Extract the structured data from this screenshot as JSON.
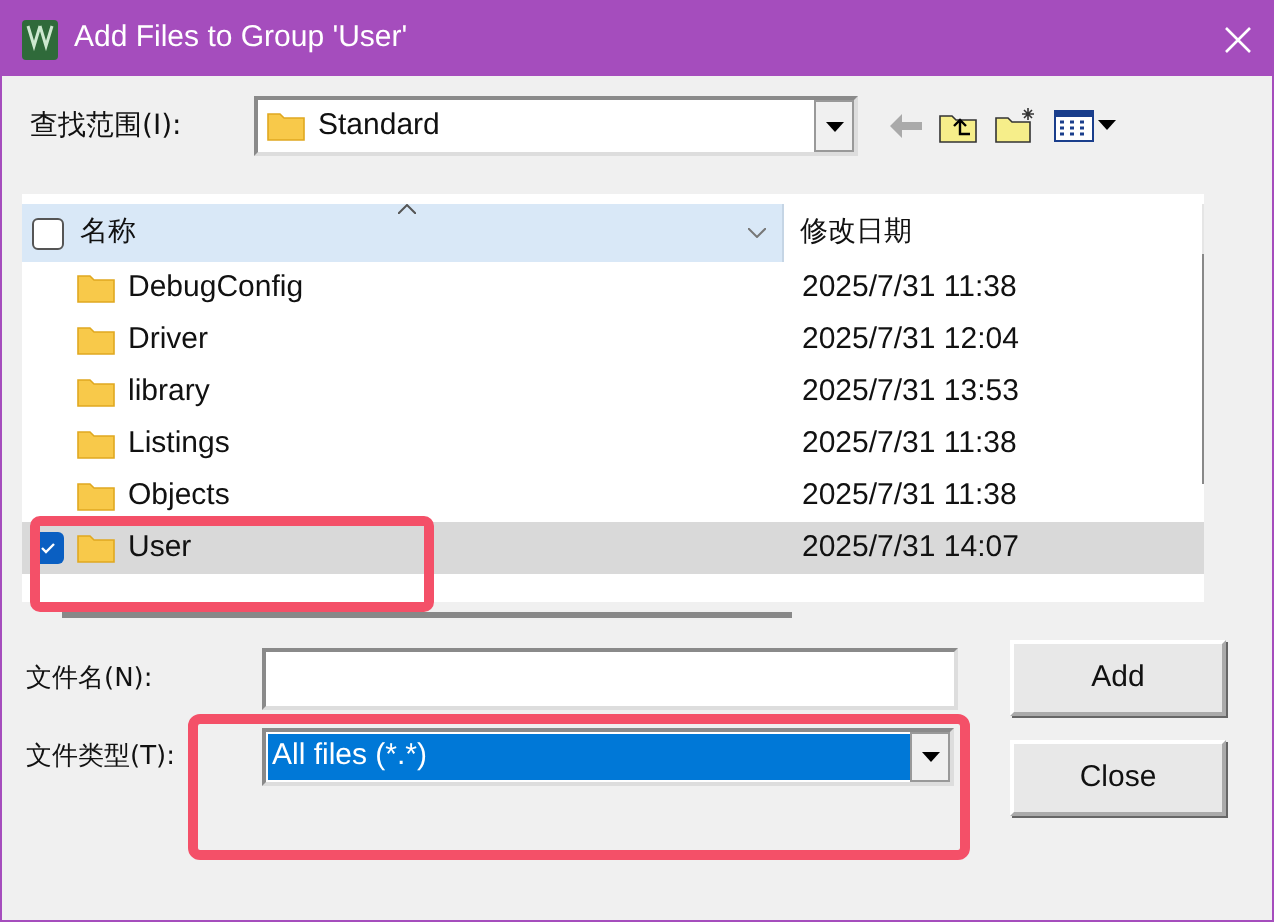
{
  "window": {
    "title": "Add Files to Group 'User'"
  },
  "look_in": {
    "label": "查找范围(I):",
    "value": "Standard"
  },
  "list": {
    "columns": [
      {
        "label": "名称",
        "checked": false
      },
      {
        "label": "修改日期"
      }
    ],
    "rows": [
      {
        "name": "DebugConfig",
        "date": "2025/7/31 11:38",
        "selected": false,
        "checked": false
      },
      {
        "name": "Driver",
        "date": "2025/7/31 12:04",
        "selected": false,
        "checked": false
      },
      {
        "name": "library",
        "date": "2025/7/31 13:53",
        "selected": false,
        "checked": false
      },
      {
        "name": "Listings",
        "date": "2025/7/31 11:38",
        "selected": false,
        "checked": false
      },
      {
        "name": "Objects",
        "date": "2025/7/31 11:38",
        "selected": false,
        "checked": false
      },
      {
        "name": "User",
        "date": "2025/7/31 14:07",
        "selected": true,
        "checked": true
      }
    ]
  },
  "file_name": {
    "label": "文件名(N):"
  },
  "file_type": {
    "label": "文件类型(T):",
    "value": "All files (*.*)"
  },
  "buttons": [
    "Add",
    "Close"
  ]
}
